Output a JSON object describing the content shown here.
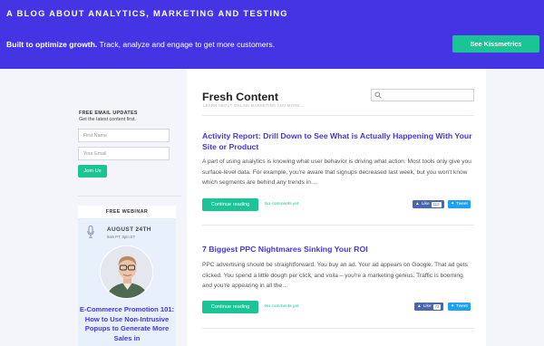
{
  "hero": {
    "tagline": "A BLOG ABOUT ANALYTICS, MARKETING AND TESTING",
    "promo_bold": "Built to optimize growth.",
    "promo_rest": " Track, analyze and engage to get more customers.",
    "cta_label": "See Kissmetrics"
  },
  "sidebar": {
    "email_title": "FREE EMAIL UPDATES",
    "email_subtitle": "Get the latest content first.",
    "first_name_placeholder": "First Name",
    "email_placeholder": "Your Email",
    "join_label": "Join Us",
    "webinar": {
      "label": "FREE WEBINAR",
      "date": "AUGUST 24TH",
      "time": "9am PT, 9pm ET",
      "title": "E-Commerce Promotion 101: How to Use Non-Intrusive Popups to Generate More Sales in"
    }
  },
  "main": {
    "title": "Fresh Content",
    "subtitle": "LEARN ABOUT ONLINE MARKETING AND MORE...",
    "search_icon": "search-icon",
    "posts": [
      {
        "title": "Activity Report: Drill Down to See What is Actually Happening With Your Site or Product",
        "excerpt": "A part of using analytics is knowing what user behavior is driving what action. Most tools only give you surface-level data. For example, you're aware that signups decreased last week, but you won't know which segments are behind any trends in…",
        "continue_label": "Continue reading",
        "comments": "No comments yet",
        "like_label": "Like",
        "like_count": "112",
        "tweet_label": "Tweet"
      },
      {
        "title": "7 Biggest PPC Nightmares Sinking Your ROI",
        "excerpt": "PPC advertising should be straightforward. You buy an ad. Your ad appears on Google. That ad gets clicked. You spend a little dough per click, and voila – you're a marketing genius. Traffic is booming and you're appearing in all the…",
        "continue_label": "Continue reading",
        "comments": "No comments yet",
        "like_label": "Like",
        "like_count": "72",
        "tweet_label": "Tweet"
      }
    ]
  },
  "colors": {
    "brand_purple": "#4534e4",
    "accent_green": "#19c495",
    "facebook_blue": "#4a67ad",
    "twitter_blue": "#1da1f2"
  }
}
